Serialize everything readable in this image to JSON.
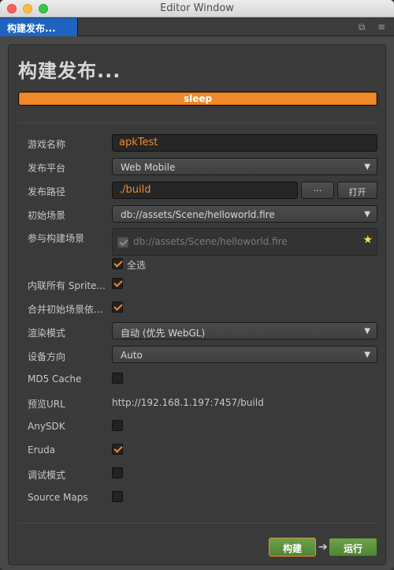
{
  "window": {
    "title": "Editor Window"
  },
  "tab": {
    "label": "构建发布...",
    "restore_icon": "restore-icon",
    "menu_icon": "menu-icon"
  },
  "heading": "构建发布...",
  "progress": {
    "text": "sleep",
    "fraction": 1.0,
    "color": "#f0892a"
  },
  "form": {
    "game_name": {
      "label": "游戏名称",
      "value": "apkTest"
    },
    "platform": {
      "label": "发布平台",
      "value": "Web Mobile"
    },
    "build_path": {
      "label": "发布路径",
      "value": "./build",
      "browse_label": "···",
      "open_label": "打开"
    },
    "start_scene": {
      "label": "初始场景",
      "value": "db://assets/Scene/helloworld.fire"
    },
    "included_scenes": {
      "label": "参与构建场景",
      "item": "db://assets/Scene/helloworld.fire",
      "select_all_label": "全选"
    },
    "inline_sprite": {
      "label": "内联所有 Sprite...",
      "checked": true
    },
    "merge_start_scene": {
      "label": "合并初始场景依...",
      "checked": true
    },
    "render_mode": {
      "label": "渲染模式",
      "value": "自动 (优先 WebGL)"
    },
    "orientation": {
      "label": "设备方向",
      "value": "Auto"
    },
    "md5_cache": {
      "label": "MD5 Cache",
      "checked": false
    },
    "preview_url": {
      "label": "预览URL",
      "value": "http://192.168.1.197:7457/build"
    },
    "anysdk": {
      "label": "AnySDK",
      "checked": false
    },
    "eruda": {
      "label": "Eruda",
      "checked": true
    },
    "debug_mode": {
      "label": "调试模式",
      "checked": false
    },
    "source_maps": {
      "label": "Source Maps",
      "checked": false
    }
  },
  "actions": {
    "build_label": "构建",
    "run_label": "运行"
  },
  "colors": {
    "accent": "#f08b2e",
    "tab_active": "#1e63c0",
    "button_green": "#5a9440"
  }
}
